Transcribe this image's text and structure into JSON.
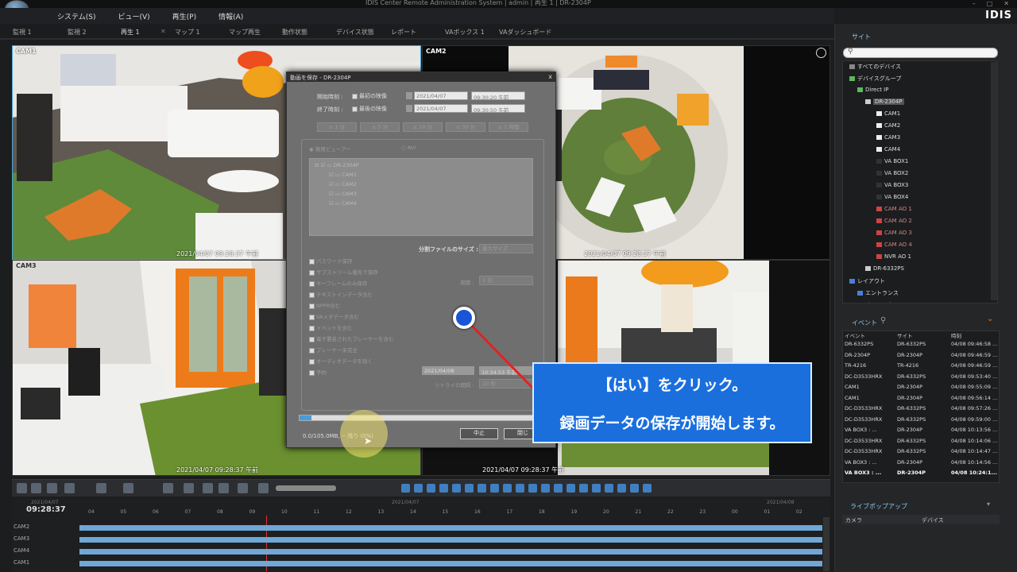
{
  "window": {
    "title": "IDIS Center Remote Administration System | admin | 再生 1 | DR-2304P",
    "controls": [
      "–",
      "□",
      "✕"
    ],
    "brand": "IDIS"
  },
  "menu": [
    "システム(S)",
    "ビュー(V)",
    "再生(P)",
    "情報(A)"
  ],
  "tabs": [
    "監視 1",
    "監視 2",
    "再生 1",
    "マップ 1",
    "マップ再生",
    "動作状態",
    "デバイス状態",
    "レポート",
    "VAボックス 1",
    "VAダッシュボード"
  ],
  "cameras": [
    {
      "label": "CAM1",
      "timestamp": "2021/04/07 09:28:37 午前"
    },
    {
      "label": "CAM2",
      "timestamp": "2021/04/07 09:28:37 午前"
    },
    {
      "label": "CAM3",
      "timestamp": "2021/04/07 09:28:37 午前"
    },
    {
      "label": "CAM4",
      "timestamp": "2021/04/07 09:28:37 午前"
    }
  ],
  "dialog": {
    "title": "動画を保存 - DR-2304P",
    "start_label": "開始時刻 :",
    "start_check": "最初の映像",
    "start_date": "2021/04/07",
    "start_time": "09:30:20 午前",
    "end_label": "終了時刻 :",
    "end_check": "最後の映像",
    "end_date": "2021/04/07",
    "end_time": "09:30:50 午前",
    "range_buttons": [
      "± 1 分",
      "± 5 分",
      "± 10 分",
      "± 30 分",
      "± 1 時間"
    ],
    "radio_player": "専用ビューアー",
    "radio_avi": "AVI",
    "tree_root": "DR-2304P",
    "tree_items": [
      "CAM1",
      "CAM2",
      "CAM3",
      "CAM4"
    ],
    "split_label": "分割ファイルのサイズ :",
    "split_value": "最大サイズ",
    "options": [
      "パスワード保存",
      "サブストリーム優先で保存",
      "キーフレームのみ保存",
      "テキストインデータ含む",
      "NPPR含む",
      "VAメタデータ含む",
      "イベントを含む",
      "電子署名されたプレーヤーを含む",
      "プレーヤー未完全",
      "オーディオデータを除く",
      "予約"
    ],
    "cycle_label": "周期 :",
    "cycle_value": "1 日",
    "sched_date": "2021/04/08",
    "sched_time": "10:34:53 午前",
    "retry_label": "リトライの間隔 :",
    "retry_value": "10 秒",
    "progress_text": "0.0/105.0MB, -- 残り (0%)",
    "progress_fraction": 0.05,
    "stop_button": "中止",
    "close_button": "閉じ"
  },
  "tip": {
    "line1": "【はい】をクリック。",
    "line2": "録画データの保存が開始します。"
  },
  "right_panel": {
    "site_header": "サイト",
    "site_tree": [
      "すべてのデバイス",
      "デバイスグループ",
      "Direct IP",
      "DR-2304P",
      "CAM1",
      "CAM2",
      "CAM3",
      "CAM4",
      "VA BOX1",
      "VA BOX2",
      "VA BOX3",
      "VA BOX4",
      "CAM AO 1",
      "CAM AO 2",
      "CAM AO 3",
      "CAM AO 4",
      "NVR AO 1",
      "DR-6332PS",
      "レイアウト",
      "エントランス",
      "オフィスカメラ"
    ],
    "events_header": "イベント",
    "event_columns": [
      "イベント",
      "サイト",
      "時刻"
    ],
    "events": [
      {
        "event": "DR-6332PS",
        "site": "DR-6332PS",
        "time": "04/08 09:46:58 ..."
      },
      {
        "event": "DR-2304P",
        "site": "DR-2304P",
        "time": "04/08 09:46:59 ..."
      },
      {
        "event": "TR-4216",
        "site": "TR-4216",
        "time": "04/08 09:46:59 ..."
      },
      {
        "event": "DC-D3533HRX",
        "site": "DR-6332PS",
        "time": "04/08 09:53:40 ..."
      },
      {
        "event": "CAM1",
        "site": "DR-2304P",
        "time": "04/08 09:55:09 ..."
      },
      {
        "event": "CAM1",
        "site": "DR-2304P",
        "time": "04/08 09:56:14 ..."
      },
      {
        "event": "DC-D3533HRX",
        "site": "DR-6332PS",
        "time": "04/08 09:57:26 ..."
      },
      {
        "event": "DC-D3533HRX",
        "site": "DR-6332PS",
        "time": "04/08 09:59:00 ..."
      },
      {
        "event": "VA BOX3 : ...",
        "site": "DR-2304P",
        "time": "04/08 10:13:56 ..."
      },
      {
        "event": "DC-D3533HRX",
        "site": "DR-6332PS",
        "time": "04/08 10:14:06 ..."
      },
      {
        "event": "DC-D3533HRX",
        "site": "DR-6332PS",
        "time": "04/08 10:14:47 ..."
      },
      {
        "event": "VA BOX3 : ...",
        "site": "DR-2304P",
        "time": "04/08 10:14:56 ..."
      },
      {
        "event": "VA BOX3 : ...",
        "site": "DR-2304P",
        "time": "04/08 10:24:1..."
      }
    ],
    "live_popup_header": "ライブポップアップ",
    "live_columns": [
      "カメラ",
      "デバイス"
    ]
  },
  "timeline": {
    "date_left": "2021/04/07",
    "time_left": "09:28:37",
    "date_center": "2021/04/07",
    "date_right": "2021/04/08",
    "hours": [
      "04",
      "05",
      "06",
      "07",
      "08",
      "09",
      "10",
      "11",
      "12",
      "13",
      "14",
      "15",
      "16",
      "17",
      "18",
      "19",
      "20",
      "21",
      "22",
      "23",
      "00",
      "01",
      "02"
    ],
    "rows": [
      "CAM2",
      "CAM3",
      "CAM4",
      "CAM1"
    ]
  },
  "colors": {
    "accent": "#1a6fdd",
    "timeline_bar": "#6fa7d6",
    "selection": "#4aa3d8"
  }
}
